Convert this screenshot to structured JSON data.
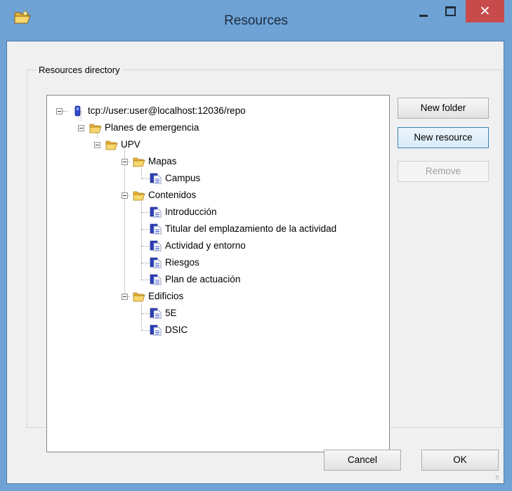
{
  "window": {
    "title": "Resources",
    "close_label": "✕"
  },
  "group": {
    "label": "Resources directory"
  },
  "tree": {
    "root": "tcp://user:user@localhost:12036/repo",
    "n1": "Planes de emergencia",
    "n2": "UPV",
    "n3": "Mapas",
    "n4": "Campus",
    "n5": "Contenidos",
    "n6": "Introducción",
    "n7": "Titular del emplazamiento de la actividad",
    "n8": "Actividad y entorno",
    "n9": "Riesgos",
    "n10": "Plan de actuación",
    "n11": "Edificios",
    "n12": "5E",
    "n13": "DSIC"
  },
  "buttons": {
    "new_folder": "New folder",
    "new_resource": "New resource",
    "remove": "Remove",
    "cancel": "Cancel",
    "ok": "OK"
  },
  "colors": {
    "title_bar": "#6fa3d6",
    "close_button": "#c84b4b",
    "folder_icon": "#f5c542",
    "resource_icon": "#3a4fc4"
  }
}
